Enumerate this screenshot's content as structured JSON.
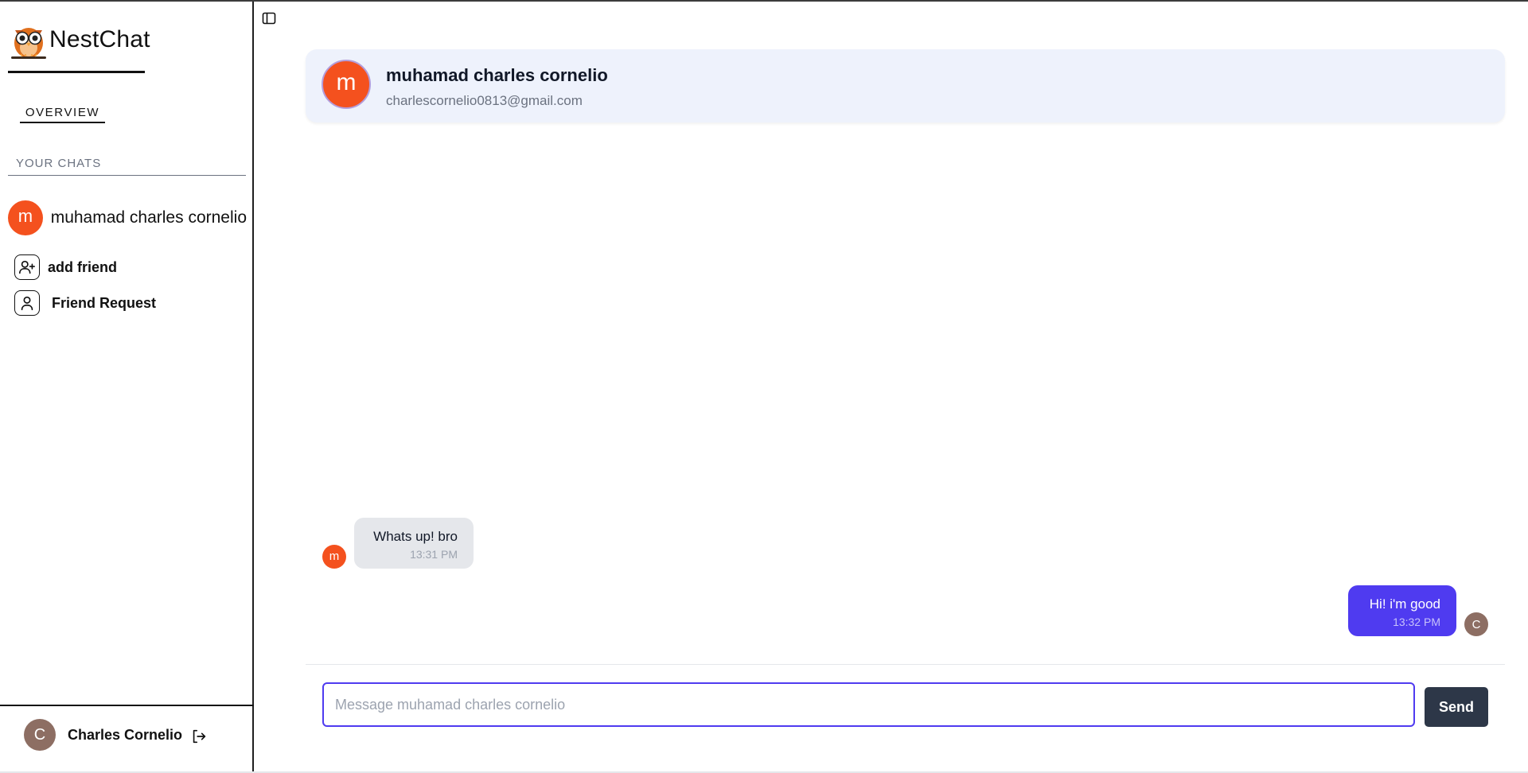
{
  "app": {
    "brand_name": "NestChat",
    "accent_color": "#4f3bf0"
  },
  "sidebar": {
    "overview_label": "OVERVIEW",
    "section_label": "YOUR CHATS",
    "chats": [
      {
        "initial": "m",
        "name": "muhamad charles cornelio",
        "avatar_color": "#f4511e"
      }
    ],
    "links": [
      {
        "icon": "user-plus-icon",
        "label": "add friend"
      },
      {
        "icon": "user-icon",
        "label": "Friend Request"
      }
    ],
    "profile": {
      "initial": "C",
      "name": "Charles Cornelio",
      "avatar_color": "#8d6e63"
    },
    "logout_icon": "logout-icon"
  },
  "chat": {
    "header": {
      "initial": "m",
      "name": "muhamad charles cornelio",
      "email": "charlescornelio0813@gmail.com"
    },
    "messages": [
      {
        "direction": "incoming",
        "sender_initial": "m",
        "text": "Whats up! bro",
        "time": "13:31 PM"
      },
      {
        "direction": "outgoing",
        "sender_initial": "C",
        "text": "Hi! i'm good",
        "time": "13:32 PM"
      }
    ],
    "composer": {
      "placeholder": "Message muhamad charles cornelio",
      "value": "",
      "send_label": "Send"
    }
  }
}
